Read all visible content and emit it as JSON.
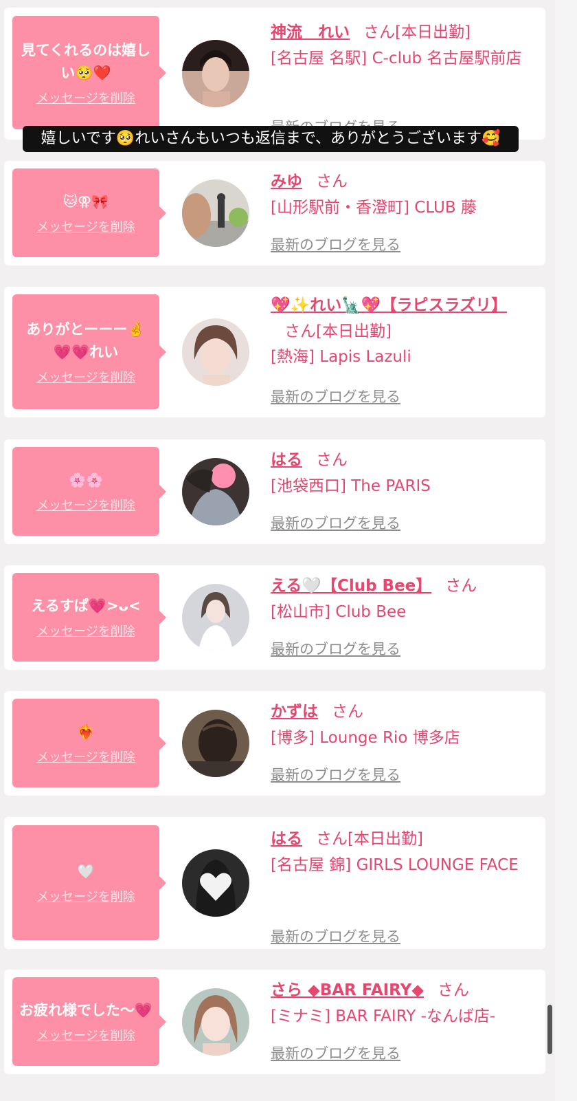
{
  "caption": "嬉しいです🥺れいさんもいつも返信まで、ありがとうございます🥰",
  "delete_label": "メッセージを削除",
  "blog_label": "最新のブログを見る",
  "san_label": "さん",
  "colors": {
    "bubble": "#fd8fa6",
    "accent": "#e7466f",
    "link_gray": "#8d8d8d",
    "background": "#f2f0f1"
  },
  "messages": [
    {
      "bubble_text": "見てくれるのは嬉しい🥺❤️",
      "name": "神流　れい",
      "badge": "[本日出勤]",
      "store": "[名古屋 名駅] C-club 名古屋駅前店",
      "avatar_icon": "woman-portrait-icon"
    },
    {
      "bubble_text": "🐱⚢🎀",
      "name": "みゆ",
      "badge": "",
      "store": "[山形駅前・香澄町] CLUB 藤",
      "avatar_icon": "street-photo-icon"
    },
    {
      "bubble_text": "ありがとーーー🤞💗💗れい",
      "name": "💖✨れい🗽💖【ラピスラズリ】",
      "badge": "[本日出勤]",
      "store": "[熱海] Lapis Lazuli",
      "avatar_icon": "woman-portrait-icon"
    },
    {
      "bubble_text": "🌸🌸",
      "name": "はる",
      "badge": "",
      "store": "[池袋西口] The PARIS",
      "avatar_icon": "blurred-face-icon"
    },
    {
      "bubble_text": "えるすぱ💗>ᴗ<",
      "name": "える🤍【Club Bee】",
      "badge": "",
      "store": "[松山市] Club Bee",
      "avatar_icon": "woman-portrait-icon"
    },
    {
      "bubble_text": "❤️‍🔥",
      "name": "かずは",
      "badge": "",
      "store": "[博多] Lounge Rio 博多店",
      "avatar_icon": "hair-photo-icon"
    },
    {
      "bubble_text": "🤍",
      "name": "はる",
      "badge": "[本日出勤]",
      "store": "[名古屋 錦] GIRLS LOUNGE FACE",
      "avatar_icon": "heart-face-icon"
    },
    {
      "bubble_text": "お疲れ様でした〜💗",
      "name": "さら ◆BAR FAIRY◆",
      "badge": "",
      "store": "[ミナミ] BAR FAIRY -なんば店-",
      "avatar_icon": "woman-portrait-icon"
    }
  ]
}
